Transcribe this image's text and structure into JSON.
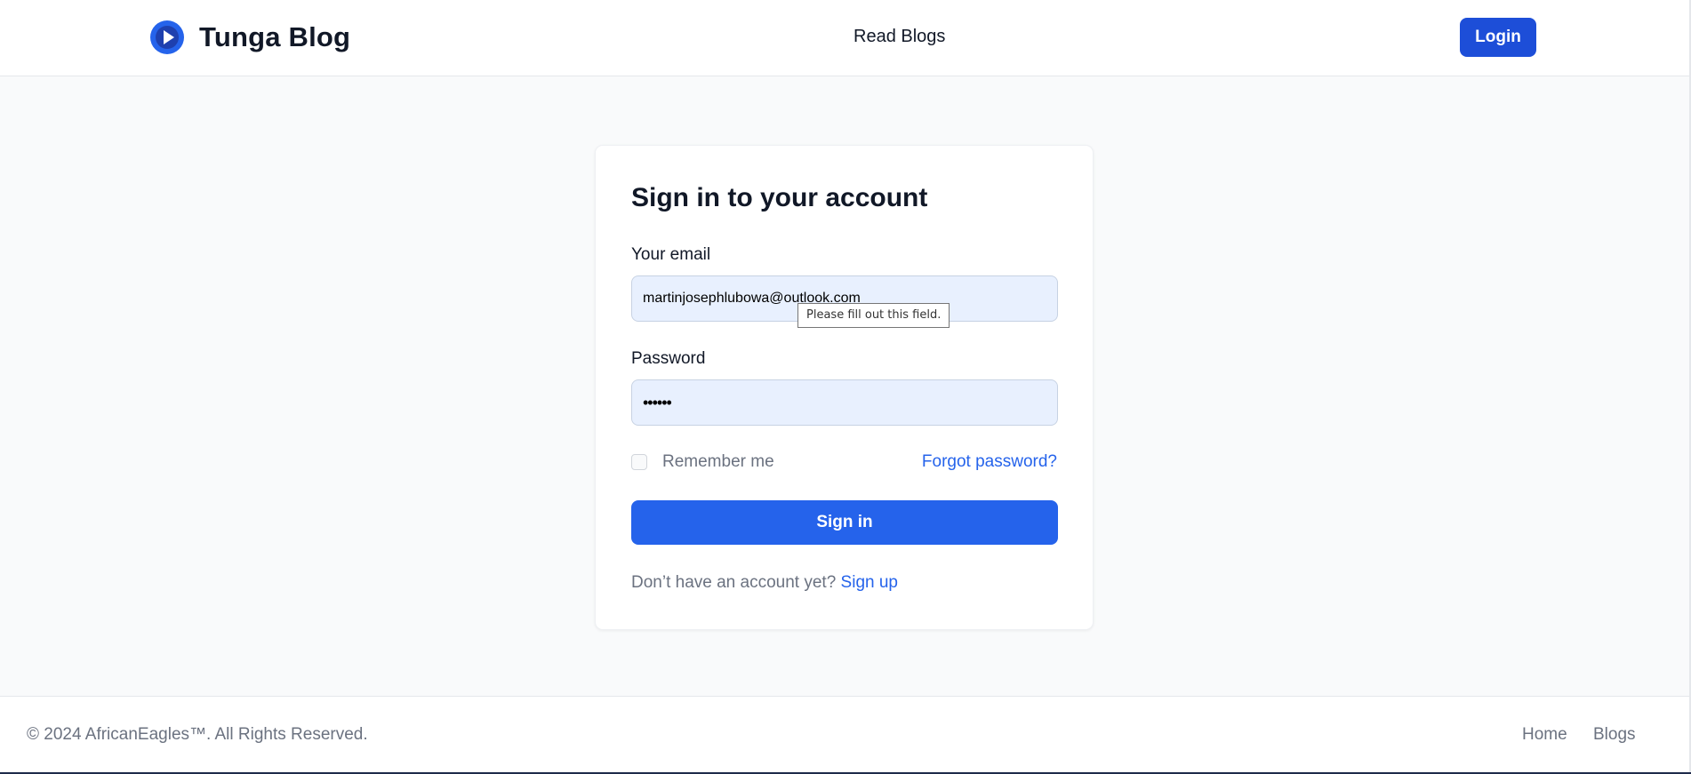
{
  "header": {
    "brand_name": "Tunga Blog",
    "nav_read_blogs": "Read Blogs",
    "login_label": "Login"
  },
  "signin_card": {
    "title": "Sign in to your account",
    "email": {
      "label": "Your email",
      "value": "martinjosephlubowa@outlook.com",
      "validation_tooltip": "Please fill out this field."
    },
    "password": {
      "label": "Password",
      "value": "••••••"
    },
    "remember_me_label": "Remember me",
    "remember_me_checked": false,
    "forgot_password_label": "Forgot password?",
    "signin_button_label": "Sign in",
    "no_account_text": "Don’t have an account yet?",
    "signup_link_label": "Sign up"
  },
  "footer": {
    "copyright": "© 2024 AfricanEagles™. All Rights Reserved.",
    "links": [
      "Home",
      "Blogs"
    ]
  },
  "colors": {
    "primary": "#2563eb",
    "login_button": "#1d4ed8",
    "page_background": "#f9fafb",
    "input_background": "#e8f0fe"
  },
  "icons": {
    "brand_logo": "play-circle-icon"
  }
}
